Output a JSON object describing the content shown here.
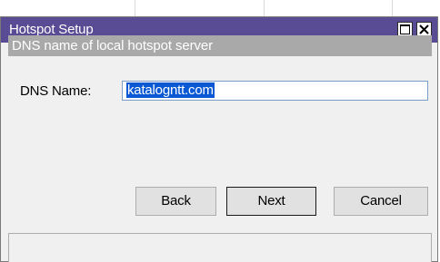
{
  "window": {
    "title": "Hotspot Setup",
    "maximize_icon": "maximize-icon",
    "close_icon": "close-icon",
    "accent_color": "#5a4b95"
  },
  "step": {
    "description": "DNS name of local hotspot server"
  },
  "form": {
    "dns_label": "DNS Name:",
    "dns_value": "katalogntt.com",
    "selection_color": "#0a58d4"
  },
  "buttons": {
    "back": "Back",
    "next": "Next",
    "cancel": "Cancel"
  }
}
